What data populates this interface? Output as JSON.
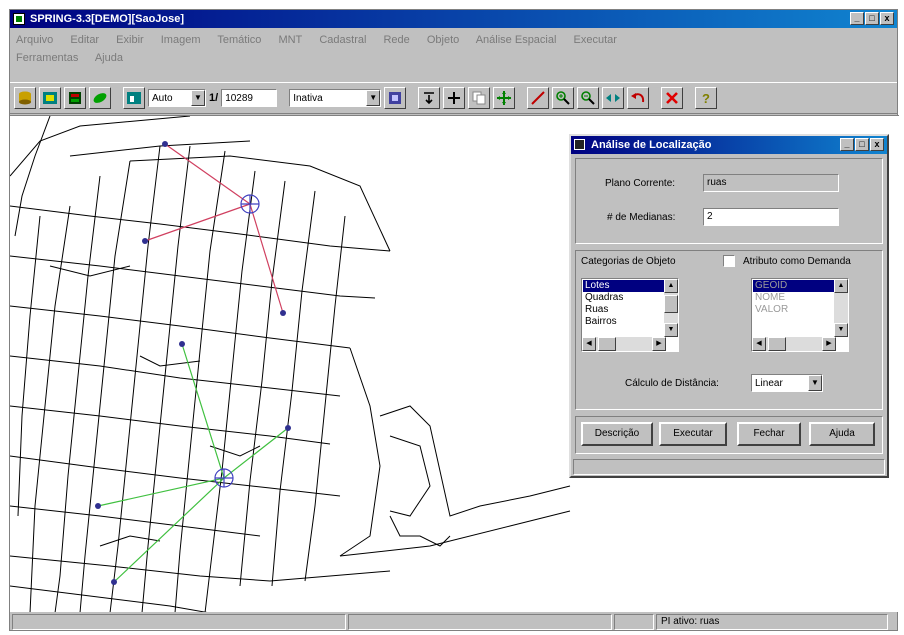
{
  "window": {
    "title": "SPRING-3.3[DEMO][SaoJose]",
    "min": "_",
    "max": "□",
    "close": "x"
  },
  "menu": {
    "items": [
      "Arquivo",
      "Editar",
      "Exibir",
      "Imagem",
      "Temático",
      "MNT",
      "Cadastral",
      "Rede",
      "Objeto",
      "Análise Espacial",
      "Executar",
      "Ferramentas",
      "Ajuda"
    ]
  },
  "toolbar": {
    "zoom_mode": "Auto",
    "scale_prefix": "1/",
    "scale_value": "10289",
    "cursor_mode": "Inativa"
  },
  "dialog": {
    "title": "Análise de Localização",
    "plano_label": "Plano Corrente:",
    "plano_value": "ruas",
    "medianas_label": "# de Medianas:",
    "medianas_value": "2",
    "categorias_label": "Categorias de Objeto",
    "atributo_label": "Atributo como Demanda",
    "categorias": [
      "Lotes",
      "Quadras",
      "Ruas",
      "Bairros"
    ],
    "atributos": [
      "GEOID",
      "NOME",
      "VALOR"
    ],
    "distancia_label": "Cálculo de Distância:",
    "distancia_value": "Linear",
    "buttons": {
      "descricao": "Descrição",
      "executar": "Executar",
      "fechar": "Fechar",
      "ajuda": "Ajuda"
    }
  },
  "status": {
    "plano_ativo": "PI ativo: ruas"
  },
  "colors": {
    "titlebar": "#000080",
    "route_red": "#d04060",
    "route_green": "#40c040",
    "node": "#303090"
  }
}
